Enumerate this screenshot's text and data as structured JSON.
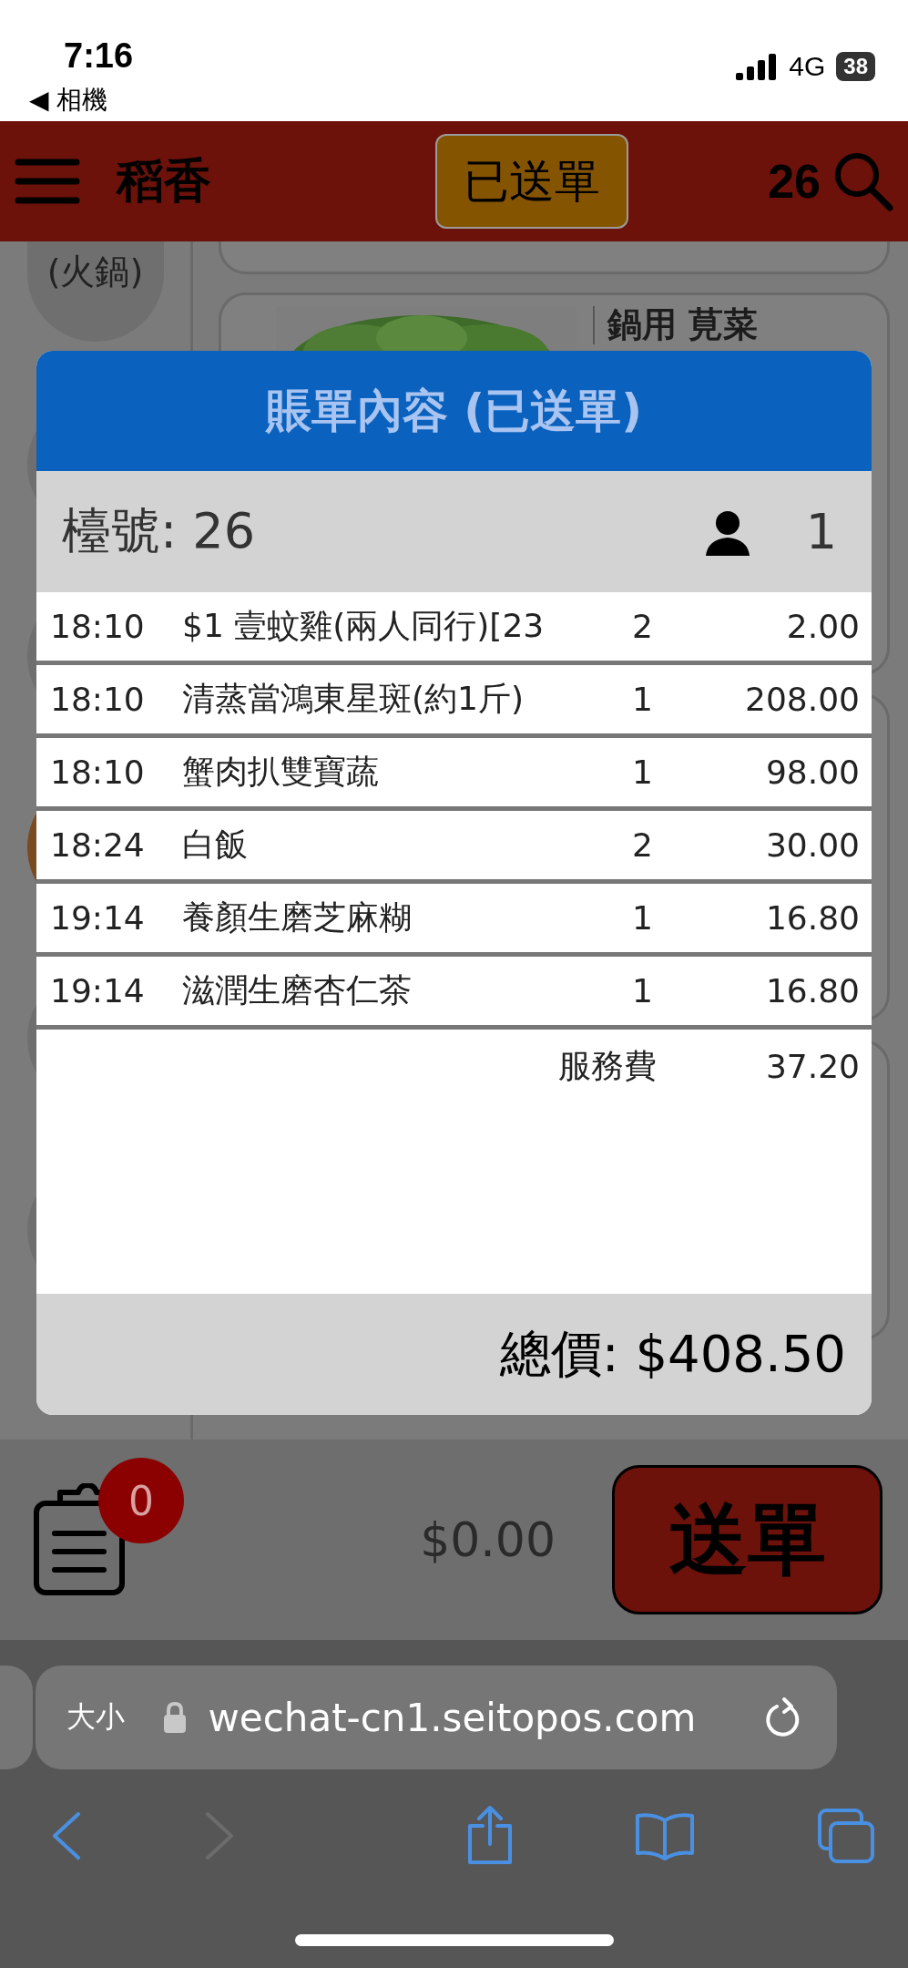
{
  "status_bar": {
    "time": "7:16",
    "back_label": "◀ 相機",
    "network": "4G",
    "battery": "38"
  },
  "header": {
    "title": "稻香",
    "status_badge": "已送單",
    "table_number": "26"
  },
  "background": {
    "category_label": "(火鍋)",
    "item_name": "鍋用 莧菜"
  },
  "bill": {
    "title": "賬單內容 (已送單)",
    "table_label": "檯號: 26",
    "guests": "1",
    "items": [
      {
        "time": "18:10",
        "name": "$1 壹蚊雞(兩人同行)[23",
        "qty": "2",
        "amount": "2.00"
      },
      {
        "time": "18:10",
        "name": "清蒸當鴻東星斑(約1斤)",
        "qty": "1",
        "amount": "208.00"
      },
      {
        "time": "18:10",
        "name": "蟹肉扒雙寶蔬",
        "qty": "1",
        "amount": "98.00"
      },
      {
        "time": "18:24",
        "name": "白飯",
        "qty": "2",
        "amount": "30.00"
      },
      {
        "time": "19:14",
        "name": "養顏生磨芝麻糊",
        "qty": "1",
        "amount": "16.80"
      },
      {
        "time": "19:14",
        "name": "滋潤生磨杏仁茶",
        "qty": "1",
        "amount": "16.80"
      }
    ],
    "service_label": "服務費",
    "service_amount": "37.20",
    "total": "總價: $408.50"
  },
  "cart": {
    "badge": "0",
    "amount": "$0.00",
    "submit": "送單"
  },
  "browser": {
    "text_size": "大小",
    "url": "wechat-cn1.seitopos.com",
    "forward_disabled": true
  }
}
